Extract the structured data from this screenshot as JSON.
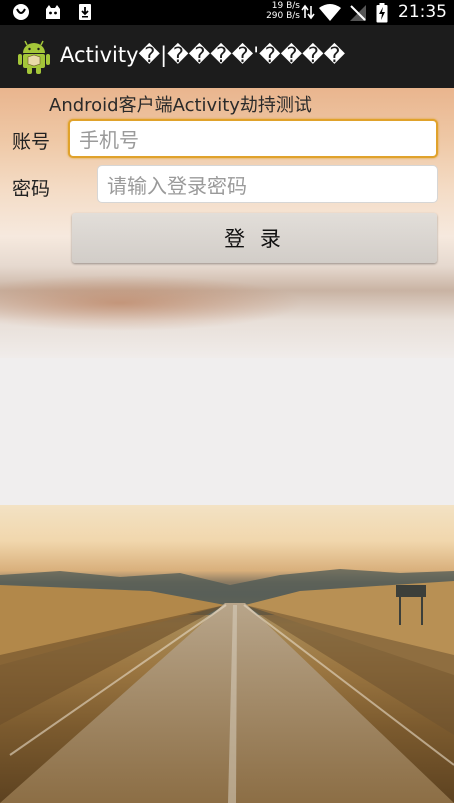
{
  "status_bar": {
    "net_up": "19 B/s",
    "net_down": "290 B/s",
    "time": "21:35",
    "icons": [
      "notification-icon",
      "cat-icon",
      "download-icon",
      "transfer-arrows-icon",
      "wifi-icon",
      "no-signal-icon",
      "battery-charging-icon"
    ]
  },
  "action_bar": {
    "title": "Activity�|����'����",
    "icon": "android-icon"
  },
  "form": {
    "subtitle": "Android客户端Activity劫持测试",
    "account_label": "账号",
    "account_placeholder": "手机号",
    "password_label": "密码",
    "password_placeholder": "请输入登录密码",
    "login_label": "登 录"
  },
  "colors": {
    "focus_border": "#e0a22b",
    "action_bar": "#1c1c1c",
    "status_bar": "#000000"
  }
}
